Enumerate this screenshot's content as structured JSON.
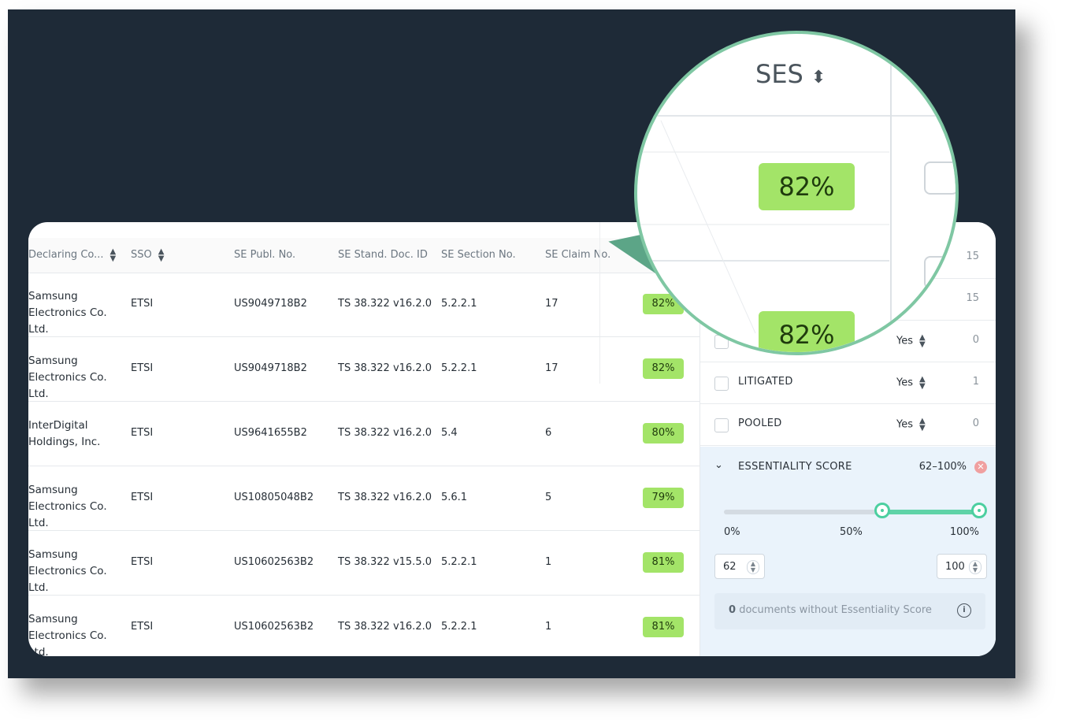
{
  "table": {
    "headers": {
      "declaring": "Declaring Co...",
      "sso": "SSO",
      "publ": "SE Publ. No.",
      "doc": "SE Stand. Doc. ID",
      "section": "SE Section No.",
      "claim": "SE Claim No."
    },
    "rows": [
      {
        "company": "Samsung Electronics Co. Ltd.",
        "sso": "ETSI",
        "publ": "US9049718B2",
        "doc": "TS 38.322 v16.2.0",
        "section": "5.2.2.1",
        "claim": "17",
        "ses": "82%"
      },
      {
        "company": "Samsung Electronics Co. Ltd.",
        "sso": "ETSI",
        "publ": "US9049718B2",
        "doc": "TS 38.322 v16.2.0",
        "section": "5.2.2.1",
        "claim": "17",
        "ses": "82%"
      },
      {
        "company": "InterDigital Holdings, Inc.",
        "sso": "ETSI",
        "publ": "US9641655B2",
        "doc": "TS 38.322 v16.2.0",
        "section": "5.4",
        "claim": "6",
        "ses": "80%"
      },
      {
        "company": "Samsung Electronics Co. Ltd.",
        "sso": "ETSI",
        "publ": "US10805048B2",
        "doc": "TS 38.322 v16.2.0",
        "section": "5.6.1",
        "claim": "5",
        "ses": "79%"
      },
      {
        "company": "Samsung Electronics Co. Ltd.",
        "sso": "ETSI",
        "publ": "US10602563B2",
        "doc": "TS 38.322 v15.5.0",
        "section": "5.2.2.1",
        "claim": "1",
        "ses": "81%"
      },
      {
        "company": "Samsung Electronics Co. Ltd.",
        "sso": "ETSI",
        "publ": "US10602563B2",
        "doc": "TS 38.322 v16.2.0",
        "section": "5.2.2.1",
        "claim": "1",
        "ses": "81%"
      }
    ]
  },
  "filters": {
    "rows": [
      {
        "label": "",
        "yes": "",
        "count": "15"
      },
      {
        "label": "",
        "yes": "",
        "count": "15"
      },
      {
        "label": "",
        "yes": "Yes",
        "count": "0"
      },
      {
        "label": "LITIGATED",
        "yes": "Yes",
        "count": "1"
      },
      {
        "label": "POOLED",
        "yes": "Yes",
        "count": "0"
      }
    ],
    "essentiality": {
      "label": "ESSENTIALITY SCORE",
      "range": "62–100%",
      "tick_min": "0%",
      "tick_mid": "50%",
      "tick_max": "100%",
      "low": 62,
      "high": 100,
      "low_value": "62",
      "high_value": "100",
      "nodoc_count": "0",
      "nodoc_text": "documents without Essentiality Score"
    }
  },
  "magnifier": {
    "header": "SES",
    "badge1": "82%",
    "badge2": "82%"
  },
  "colors": {
    "background": "#1e2a37",
    "ses_badge": "#a3e468",
    "accent": "#4ccfa0",
    "panel_highlight": "#eaf3fb"
  }
}
